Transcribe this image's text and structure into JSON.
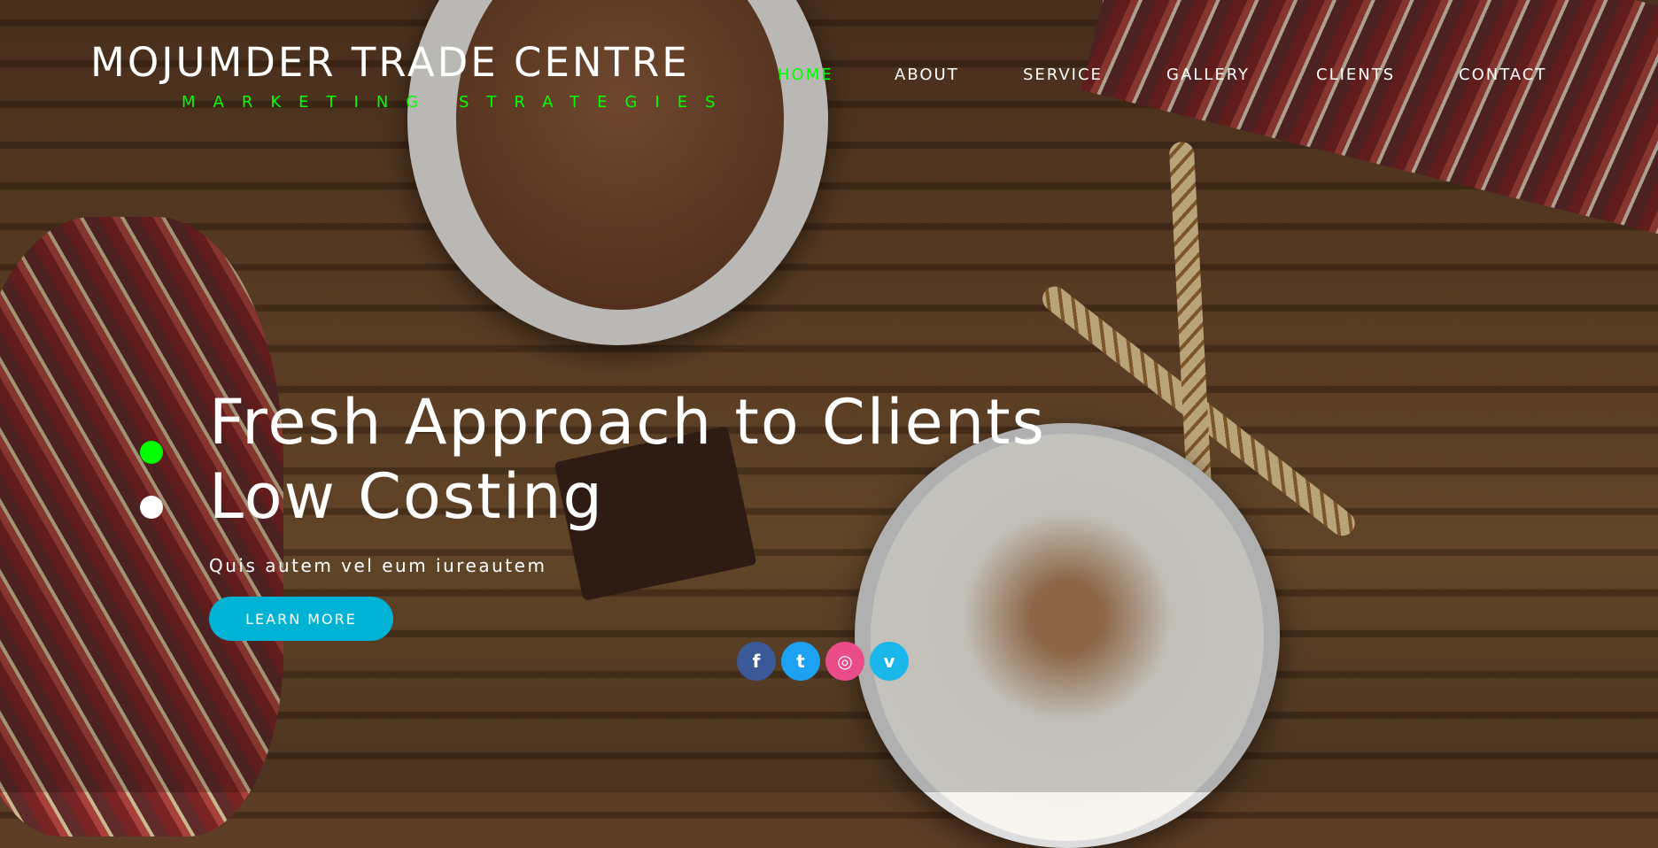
{
  "brand": {
    "name": "MOJUMDER TRADE CENTRE",
    "tagline": "MARKETING STRATEGIES"
  },
  "nav": {
    "items": [
      {
        "label": "HOME",
        "active": true
      },
      {
        "label": "ABOUT"
      },
      {
        "label": "SERVICE"
      },
      {
        "label": "GALLERY"
      },
      {
        "label": "CLIENTS"
      },
      {
        "label": "CONTACT"
      }
    ]
  },
  "hero": {
    "line1": "Fresh Approach to Clients",
    "line2": "Low Costing",
    "subtitle": "Quis autem vel eum iureautem",
    "button": "LEARN MORE",
    "slides": [
      {
        "active": true
      },
      {
        "active": false
      }
    ]
  },
  "social": [
    {
      "name": "facebook-icon",
      "glyph": "f",
      "color": "#3b5998"
    },
    {
      "name": "twitter-icon",
      "glyph": "t",
      "color": "#1da1f2"
    },
    {
      "name": "dribbble-icon",
      "glyph": "◎",
      "color": "#ea4c89"
    },
    {
      "name": "vimeo-icon",
      "glyph": "v",
      "color": "#1ab7ea"
    }
  ],
  "colors": {
    "accent": "#00ff00",
    "button": "#00b3d4"
  }
}
